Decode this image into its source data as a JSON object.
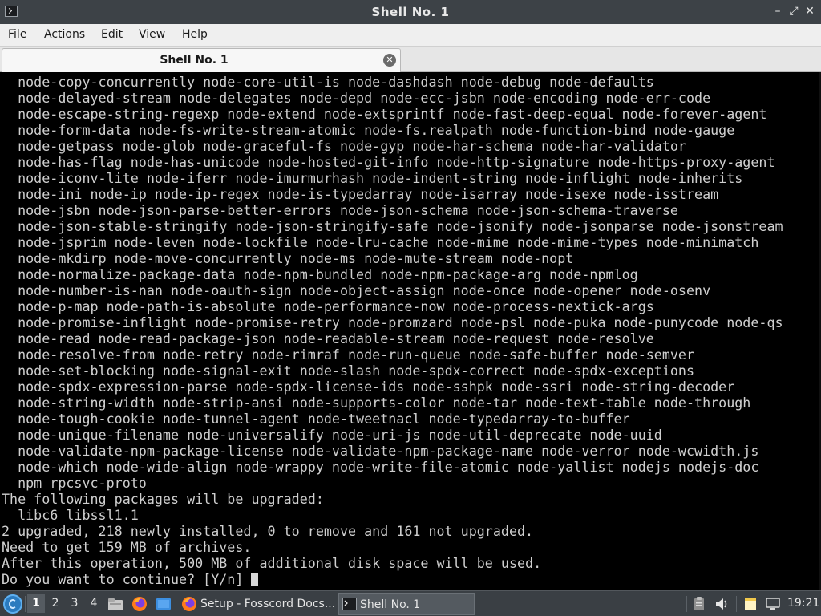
{
  "window": {
    "title": "Shell No. 1",
    "minimize_glyph": "–",
    "maximize_glyph": "⤢",
    "close_glyph": "✕"
  },
  "menu": {
    "items": [
      "File",
      "Actions",
      "Edit",
      "View",
      "Help"
    ]
  },
  "tab": {
    "label": "Shell No. 1",
    "close_glyph": "✕"
  },
  "terminal": {
    "lines": [
      "  node-copy-concurrently node-core-util-is node-dashdash node-debug node-defaults",
      "  node-delayed-stream node-delegates node-depd node-ecc-jsbn node-encoding node-err-code",
      "  node-escape-string-regexp node-extend node-extsprintf node-fast-deep-equal node-forever-agent",
      "  node-form-data node-fs-write-stream-atomic node-fs.realpath node-function-bind node-gauge",
      "  node-getpass node-glob node-graceful-fs node-gyp node-har-schema node-har-validator",
      "  node-has-flag node-has-unicode node-hosted-git-info node-http-signature node-https-proxy-agent",
      "  node-iconv-lite node-iferr node-imurmurhash node-indent-string node-inflight node-inherits",
      "  node-ini node-ip node-ip-regex node-is-typedarray node-isarray node-isexe node-isstream",
      "  node-jsbn node-json-parse-better-errors node-json-schema node-json-schema-traverse",
      "  node-json-stable-stringify node-json-stringify-safe node-jsonify node-jsonparse node-jsonstream",
      "  node-jsprim node-leven node-lockfile node-lru-cache node-mime node-mime-types node-minimatch",
      "  node-mkdirp node-move-concurrently node-ms node-mute-stream node-nopt",
      "  node-normalize-package-data node-npm-bundled node-npm-package-arg node-npmlog",
      "  node-number-is-nan node-oauth-sign node-object-assign node-once node-opener node-osenv",
      "  node-p-map node-path-is-absolute node-performance-now node-process-nextick-args",
      "  node-promise-inflight node-promise-retry node-promzard node-psl node-puka node-punycode node-qs",
      "  node-read node-read-package-json node-readable-stream node-request node-resolve",
      "  node-resolve-from node-retry node-rimraf node-run-queue node-safe-buffer node-semver",
      "  node-set-blocking node-signal-exit node-slash node-spdx-correct node-spdx-exceptions",
      "  node-spdx-expression-parse node-spdx-license-ids node-sshpk node-ssri node-string-decoder",
      "  node-string-width node-strip-ansi node-supports-color node-tar node-text-table node-through",
      "  node-tough-cookie node-tunnel-agent node-tweetnacl node-typedarray-to-buffer",
      "  node-unique-filename node-universalify node-uri-js node-util-deprecate node-uuid",
      "  node-validate-npm-package-license node-validate-npm-package-name node-verror node-wcwidth.js",
      "  node-which node-wide-align node-wrappy node-write-file-atomic node-yallist nodejs nodejs-doc",
      "  npm rpcsvc-proto",
      "The following packages will be upgraded:",
      "  libc6 libssl1.1",
      "2 upgraded, 218 newly installed, 0 to remove and 161 not upgraded.",
      "Need to get 159 MB of archives.",
      "After this operation, 500 MB of additional disk space will be used."
    ],
    "prompt": "Do you want to continue? [Y/n] "
  },
  "taskbar": {
    "workspaces": [
      "1",
      "2",
      "3",
      "4"
    ],
    "active_workspace": "1",
    "quick_launch": [
      "file-manager-icon",
      "firefox-icon",
      "desktop-icon"
    ],
    "tasks": [
      {
        "label": "Setup - Fosscord Docs...",
        "icon": "firefox-icon"
      },
      {
        "label": "Shell No. 1",
        "icon": "terminal-icon"
      }
    ],
    "tray": [
      "clipboard-icon",
      "volume-icon",
      "notes-icon",
      "network-icon"
    ],
    "clock": "19:21"
  },
  "colors": {
    "terminal_bg": "#000000",
    "terminal_fg": "#cfcfcf",
    "titlebar_bg": "#3d4247",
    "taskbar_bg": "#3a3f44"
  }
}
